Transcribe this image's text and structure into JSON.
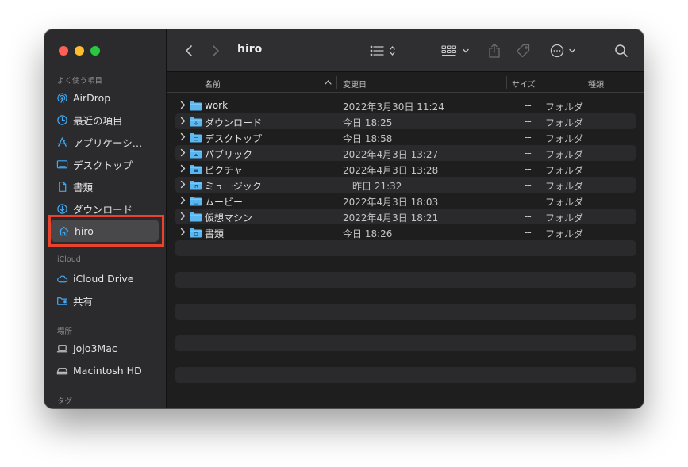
{
  "window": {
    "title": "hiro"
  },
  "sidebar": {
    "sections": [
      {
        "label": "よく使う項目"
      },
      {
        "label": "iCloud"
      },
      {
        "label": "場所"
      },
      {
        "label": "タグ"
      }
    ],
    "favorites": [
      {
        "label": "AirDrop",
        "icon": "airdrop-icon"
      },
      {
        "label": "最近の項目",
        "icon": "clock-icon"
      },
      {
        "label": "アプリケーシ…",
        "icon": "applications-icon"
      },
      {
        "label": "デスクトップ",
        "icon": "desktop-icon"
      },
      {
        "label": "書類",
        "icon": "document-icon"
      },
      {
        "label": "ダウンロード",
        "icon": "download-icon"
      },
      {
        "label": "hiro",
        "icon": "home-icon",
        "selected": true
      }
    ],
    "icloud": [
      {
        "label": "iCloud Drive",
        "icon": "cloud-icon"
      },
      {
        "label": "共有",
        "icon": "shared-folder-icon"
      }
    ],
    "locations": [
      {
        "label": "Jojo3Mac",
        "icon": "laptop-icon"
      },
      {
        "label": "Macintosh HD",
        "icon": "drive-icon"
      }
    ]
  },
  "columns": {
    "name": "名前",
    "modified": "変更日",
    "size": "サイズ",
    "kind": "種類"
  },
  "files": [
    {
      "name": "work",
      "date": "2022年3月30日 11:24",
      "size": "--",
      "kind": "フォルダ",
      "badge": ""
    },
    {
      "name": "ダウンロード",
      "date": "今日 18:25",
      "size": "--",
      "kind": "フォルダ",
      "badge": "download"
    },
    {
      "name": "デスクトップ",
      "date": "今日 18:58",
      "size": "--",
      "kind": "フォルダ",
      "badge": "desktop"
    },
    {
      "name": "パブリック",
      "date": "2022年4月3日 13:27",
      "size": "--",
      "kind": "フォルダ",
      "badge": "public"
    },
    {
      "name": "ピクチャ",
      "date": "2022年4月3日 13:28",
      "size": "--",
      "kind": "フォルダ",
      "badge": "pictures"
    },
    {
      "name": "ミュージック",
      "date": "一昨日 21:32",
      "size": "--",
      "kind": "フォルダ",
      "badge": "music"
    },
    {
      "name": "ムービー",
      "date": "2022年4月3日 18:03",
      "size": "--",
      "kind": "フォルダ",
      "badge": "movies"
    },
    {
      "name": "仮想マシン",
      "date": "2022年4月3日 18:21",
      "size": "--",
      "kind": "フォルダ",
      "badge": ""
    },
    {
      "name": "書類",
      "date": "今日 18:26",
      "size": "--",
      "kind": "フォルダ",
      "badge": "documents"
    }
  ],
  "colors": {
    "accent": "#3fa9f5",
    "folder": "#5ab7f0",
    "highlight": "#e8442d"
  }
}
